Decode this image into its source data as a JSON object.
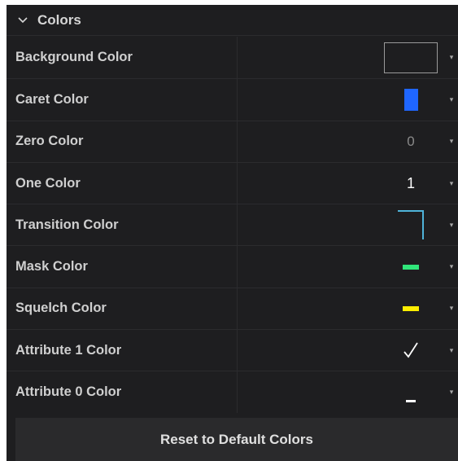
{
  "section": {
    "title": "Colors",
    "icon": "chevron-down-icon"
  },
  "rows": [
    {
      "label": "Background Color",
      "swatch": "empty-box",
      "color": "#1e1e20"
    },
    {
      "label": "Caret Color",
      "swatch": "solid-block",
      "color": "#1f66ff"
    },
    {
      "label": "Zero Color",
      "swatch": "text",
      "text": "0",
      "color": "#8a8a8a"
    },
    {
      "label": "One Color",
      "swatch": "text",
      "text": "1",
      "color": "#ffffff"
    },
    {
      "label": "Transition Color",
      "swatch": "corner-line",
      "color": "#4fb3d9"
    },
    {
      "label": "Mask Color",
      "swatch": "bar",
      "color": "#30e67a"
    },
    {
      "label": "Squelch Color",
      "swatch": "bar",
      "color": "#ffee00"
    },
    {
      "label": "Attribute 1 Color",
      "swatch": "checkmark",
      "color": "#ffffff"
    },
    {
      "label": "Attribute 0 Color",
      "swatch": "dash",
      "color": "#ffffff"
    }
  ],
  "reset_button": {
    "label": "Reset to Default Colors"
  },
  "dropdown_icon": "caret-down-icon"
}
